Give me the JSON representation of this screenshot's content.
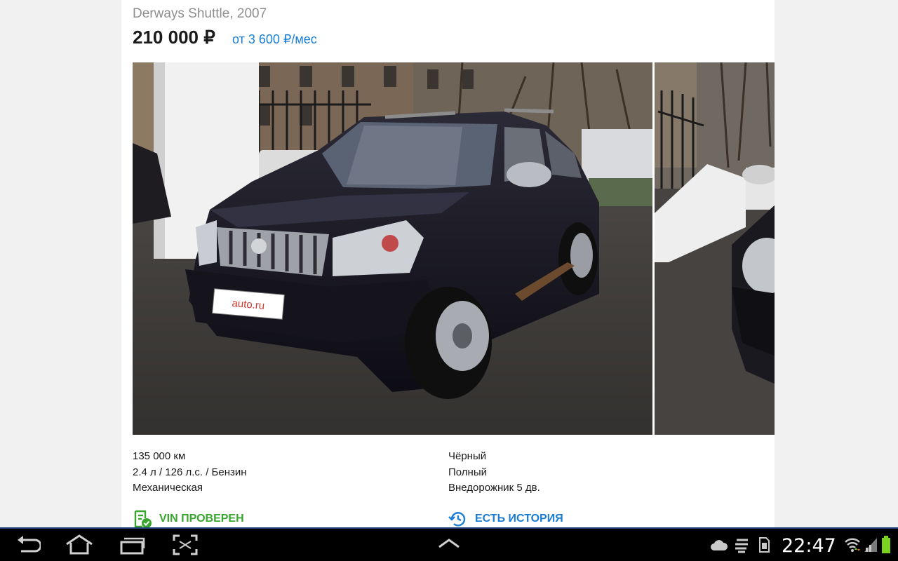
{
  "listing": {
    "title": "Derways Shuttle, 2007",
    "price": "210 000 ₽",
    "credit": "от 3 600 ₽/мес",
    "specs_left": [
      "135 000 км",
      "2.4 л / 126 л.с. / Бензин",
      "Механическая"
    ],
    "specs_right": [
      "Чёрный",
      "Полный",
      "Внедорожник 5 дв."
    ],
    "vin_badge": "VIN ПРОВЕРЕН",
    "history_badge": "ЕСТЬ ИСТОРИЯ",
    "plate_text": "auto.ru"
  },
  "system_bar": {
    "clock": "22:47",
    "nav_icons": [
      "back-icon",
      "home-icon",
      "recent-apps-icon",
      "screenshot-icon",
      "chevron-up-icon"
    ],
    "status_icons": [
      "cloud-icon",
      "notification-icon",
      "sd-card-icon",
      "wifi-icon",
      "signal-icon",
      "battery-icon"
    ]
  },
  "colors": {
    "title_gray": "#8e8e8e",
    "link_blue": "#1a7fd4",
    "vin_green": "#3aa52f",
    "battery_green": "#7ad11f"
  }
}
